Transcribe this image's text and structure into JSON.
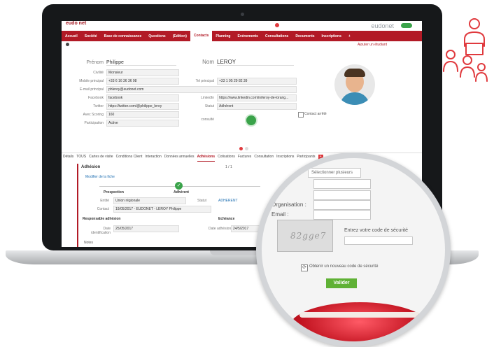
{
  "app": {
    "logo": "eudo\nnet",
    "brand": "eudonet"
  },
  "nav": [
    "Accueil",
    "Société",
    "Base de connaissance",
    "Questions",
    "(Edition)",
    "Contacts",
    "Planning",
    "Evénements",
    "Consultations",
    "Documents",
    "Inscriptions",
    "+"
  ],
  "subbar": "Ajouter un étudiant",
  "contact": {
    "prenom_label": "Prénom",
    "prenom": "Philippe",
    "nom_label": "Nom",
    "nom": "LEROY",
    "civilite_label": "Civilité",
    "civilite": "Monsieur",
    "mobile_label": "Mobile principal",
    "mobile": "+33 6 16 36 36 98",
    "email_label": "E-mail principal",
    "email": "phleroy@eudonet.com",
    "tel_label": "Tel principal",
    "tel": "+33 1 95 29 82 39",
    "facebook_label": "Facebook",
    "facebook": "facebook",
    "twitter_label": "Twitter",
    "twitter": "https://twitter.com/@philippe_leroy",
    "linkedin_label": "LinkedIn",
    "linkedin": "https://www.linkedin.com/in/leroy-de-lorang...",
    "statut_label": "Statut",
    "statut": "Adhérent",
    "scoring_label": "Avec Scoring",
    "scoring": "160",
    "participation_label": "Participation",
    "participation": "Active",
    "consultation_label": "consulté",
    "contact_arrete": "Contact arrêté"
  },
  "tabs": [
    "Détails",
    "TOUS",
    "Cartes de visite",
    "Conditions Client",
    "Interaction",
    "Données annuelles",
    "Adhésions",
    "Cotisations",
    "Factures",
    "Consultation",
    "Inscriptions",
    "Participants"
  ],
  "adhesion": {
    "title": "Adhésion",
    "pager": "1 / 1",
    "link": "Modifier de la fiche",
    "prospection": "Prospection",
    "adherent": "Adhérent",
    "entite_label": "Entité",
    "entite": "Union régionale",
    "contact_label": "Contact",
    "contact": "19/05/2017 - EUDONET - LEROY Philippe",
    "statut_label": "Statut",
    "statut": "ADHERENT",
    "responsable": "Responsable adhésion",
    "date_label": "Date identification",
    "date": "25/05/2017",
    "echeance": "Echéance",
    "date_adh_label": "Date adhésion",
    "date_adh": "24/5/2017",
    "notes": "Notes"
  },
  "magnifier": {
    "select": "Sélectionner plusieurs",
    "org_label": "Organisation :",
    "email_label": "Email :",
    "captcha_text": "82gge7",
    "code_label": "Entrez votre code de sécurité",
    "new_code": "Obtenir un nouveau code de sécurité",
    "submit": "Valider"
  },
  "colors": {
    "brand": "#b21a26",
    "green": "#5fb135",
    "accent_icon": "#e03a3e"
  }
}
